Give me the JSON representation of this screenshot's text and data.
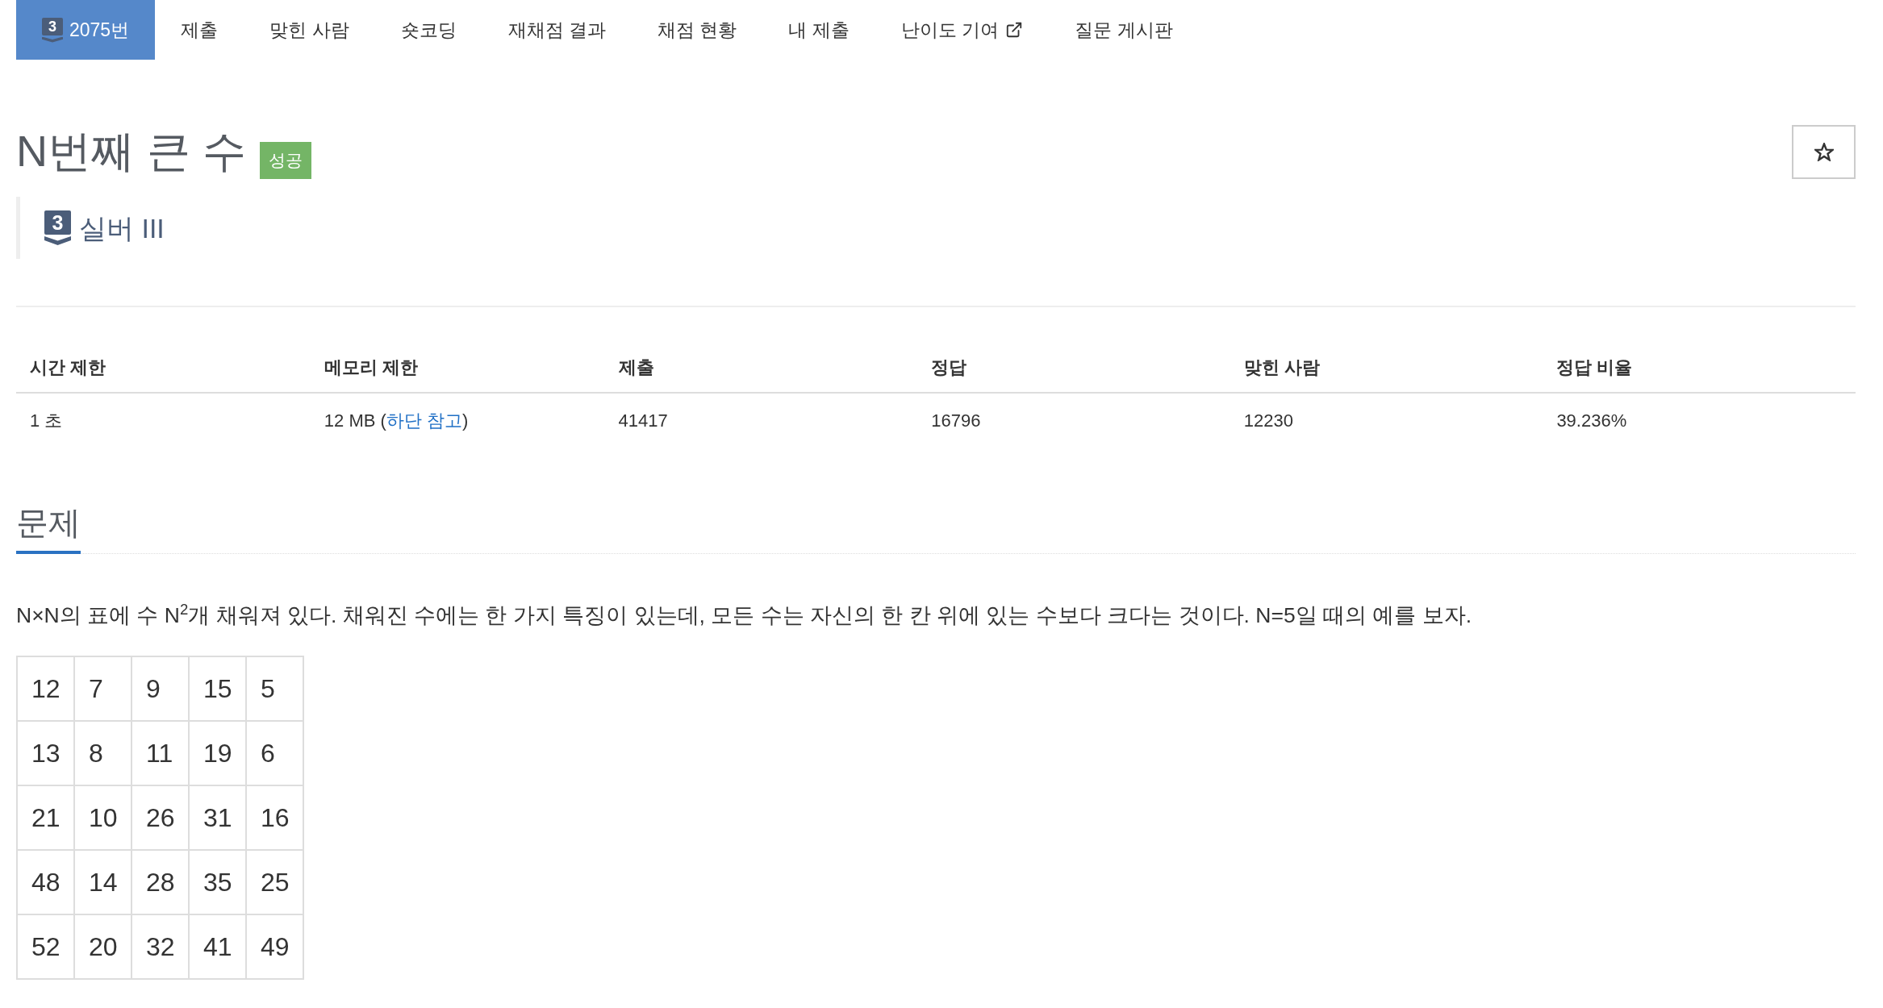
{
  "nav_tabs": [
    {
      "label": "2075번",
      "selected": true,
      "tier_badge": "3",
      "external": false
    },
    {
      "label": "제출",
      "selected": false,
      "external": false
    },
    {
      "label": "맞힌 사람",
      "selected": false,
      "external": false
    },
    {
      "label": "숏코딩",
      "selected": false,
      "external": false
    },
    {
      "label": "재채점 결과",
      "selected": false,
      "external": false
    },
    {
      "label": "채점 현황",
      "selected": false,
      "external": false
    },
    {
      "label": "내 제출",
      "selected": false,
      "external": false
    },
    {
      "label": "난이도 기여",
      "selected": false,
      "external": true
    },
    {
      "label": "질문 게시판",
      "selected": false,
      "external": false
    }
  ],
  "problem": {
    "title": "N번째 큰 수",
    "result_badge": "성공",
    "tier_badge": "3",
    "tier": "실버 III",
    "starred": false
  },
  "stats_table": {
    "columns": [
      "시간 제한",
      "메모리 제한",
      "제출",
      "정답",
      "맞힌 사람",
      "정답 비율"
    ],
    "rows": [
      [
        {
          "text": "1 초"
        },
        {
          "text": "12 MB (",
          "link": "하단 참고",
          "suffix": ")"
        },
        {
          "text": "41417"
        },
        {
          "text": "16796"
        },
        {
          "text": "12230"
        },
        {
          "text": "39.236%"
        }
      ]
    ]
  },
  "description": {
    "heading": "문제",
    "paragraph": "N×N의 표에 수 N$^{2}$개 채워져 있다. 채워진 수에는 한 가지 특징이 있는데, 모든 수는 자신의 한 칸 위에 있는 수보다 크다는 것이다. N=5일 때의 예를 보자.",
    "grid": [
      [
        "12",
        "7",
        "9",
        "15",
        "5"
      ],
      [
        "13",
        "8",
        "11",
        "19",
        "6"
      ],
      [
        "21",
        "10",
        "26",
        "31",
        "16"
      ],
      [
        "48",
        "14",
        "28",
        "35",
        "25"
      ],
      [
        "52",
        "20",
        "32",
        "41",
        "49"
      ]
    ]
  }
}
